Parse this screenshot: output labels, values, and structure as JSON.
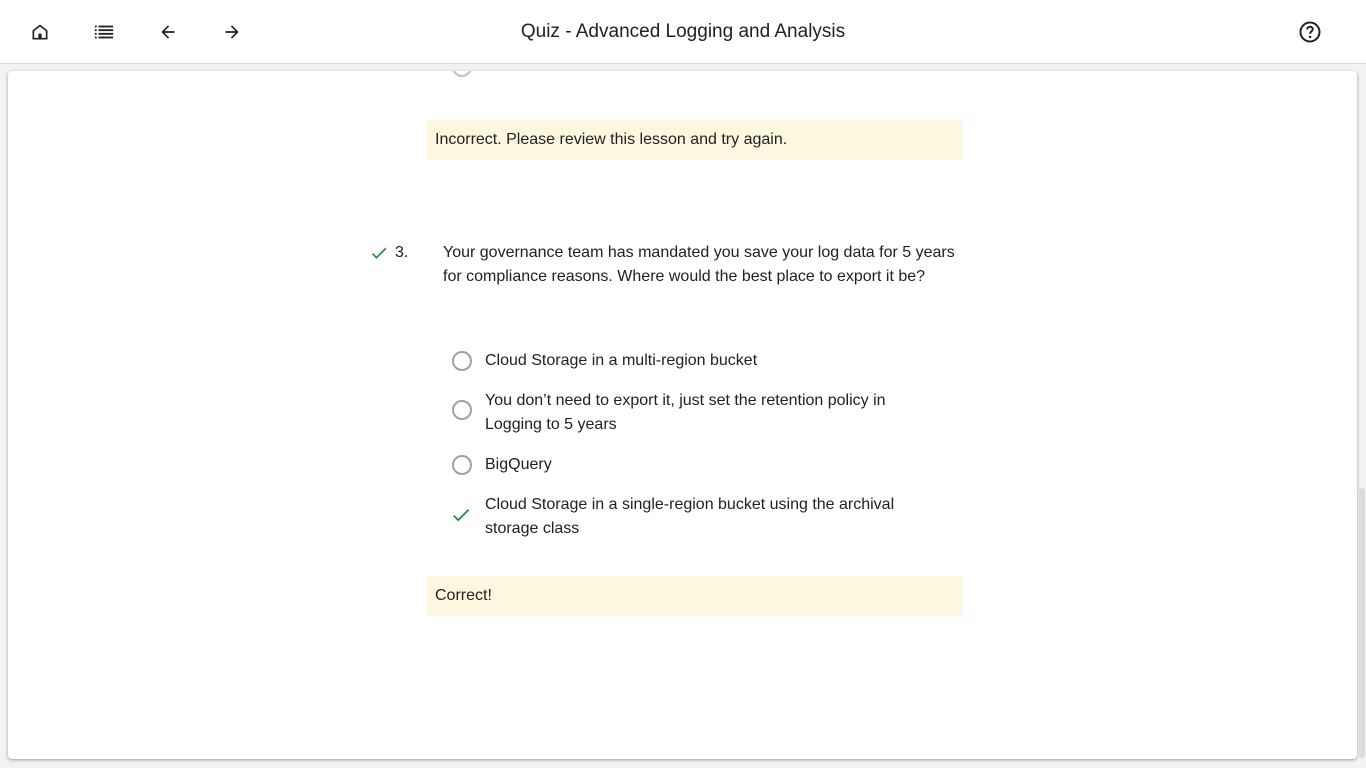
{
  "header": {
    "title": "Quiz - Advanced Logging and Analysis",
    "icons": [
      "home-icon",
      "list-icon",
      "arrow-back-icon",
      "arrow-forward-icon",
      "help-icon"
    ]
  },
  "feedback_prev": "Incorrect. Please review this lesson and try again.",
  "question": {
    "number": "3.",
    "text": "Your governance team has mandated you save your log data for 5 years for compliance reasons. Where would the best place to export it be?",
    "status": "correct",
    "options": [
      {
        "label": "Cloud Storage in a multi-region bucket",
        "selected": false
      },
      {
        "label": "You don’t need to export it, just set the retention policy in Logging to 5 years",
        "selected": false
      },
      {
        "label": "BigQuery",
        "selected": false
      },
      {
        "label": "Cloud Storage in a single-region bucket using the archival storage class",
        "selected": true
      }
    ],
    "feedback": "Correct!"
  },
  "colors": {
    "correct_check": "#1e8e3e",
    "feedback_bg": "#fef7e0"
  }
}
